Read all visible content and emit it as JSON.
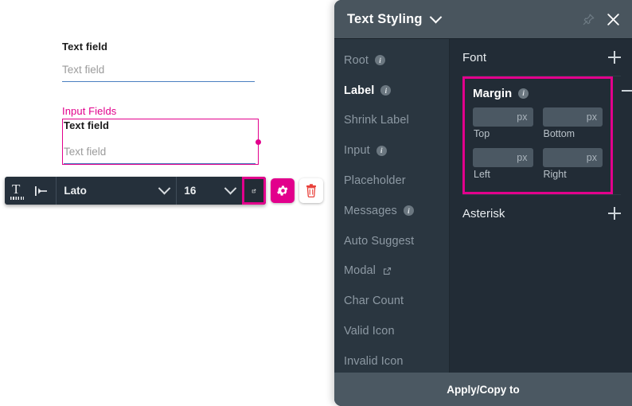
{
  "canvas": {
    "plain_field": {
      "label": "Text field",
      "placeholder": "Text field"
    },
    "selected_field": {
      "selection_title": "Input Fields",
      "label": "Text field",
      "placeholder": "Text field"
    }
  },
  "toolbar": {
    "text_icon": "text-format-icon",
    "align_icon": "align-left-icon",
    "font_family": "Lato",
    "font_size": "16",
    "expand_icon": "open-in-new-icon",
    "settings_icon": "gear-icon",
    "delete_icon": "trash-icon"
  },
  "panel": {
    "title": "Text Styling",
    "title_chevron": "chevron-down-icon",
    "pin_icon": "pin-icon",
    "close_icon": "close-icon",
    "nav": [
      {
        "label": "Root",
        "info": true,
        "external": false,
        "active": false
      },
      {
        "label": "Label",
        "info": true,
        "external": false,
        "active": true
      },
      {
        "label": "Shrink Label",
        "info": false,
        "external": false,
        "active": false
      },
      {
        "label": "Input",
        "info": true,
        "external": false,
        "active": false
      },
      {
        "label": "Placeholder",
        "info": false,
        "external": false,
        "active": false
      },
      {
        "label": "Messages",
        "info": true,
        "external": false,
        "active": false
      },
      {
        "label": "Auto Suggest",
        "info": false,
        "external": false,
        "active": false
      },
      {
        "label": "Modal",
        "info": false,
        "external": true,
        "active": false
      },
      {
        "label": "Char Count",
        "info": false,
        "external": false,
        "active": false
      },
      {
        "label": "Valid Icon",
        "info": false,
        "external": false,
        "active": false
      },
      {
        "label": "Invalid Icon",
        "info": false,
        "external": false,
        "active": false
      }
    ],
    "sections": {
      "font": {
        "title": "Font",
        "toggle_icon": "plus-icon"
      },
      "margin": {
        "title": "Margin",
        "toggle_icon": "minus-icon",
        "highlight_color": "#e2008c",
        "fields": [
          {
            "value": "",
            "unit": "px",
            "caption": "Top"
          },
          {
            "value": "",
            "unit": "px",
            "caption": "Bottom"
          },
          {
            "value": "",
            "unit": "px",
            "caption": "Left"
          },
          {
            "value": "",
            "unit": "px",
            "caption": "Right"
          }
        ]
      },
      "asterisk": {
        "title": "Asterisk",
        "toggle_icon": "plus-icon"
      }
    },
    "footer_label": "Apply/Copy to"
  },
  "colors": {
    "accent_magenta": "#e2008c",
    "panel_bg": "#222c36",
    "panel_nav_bg": "#2a3640",
    "panel_header_bg": "#49555e",
    "footer_bg": "#4b5862",
    "input_underline": "#4a7fc1"
  }
}
